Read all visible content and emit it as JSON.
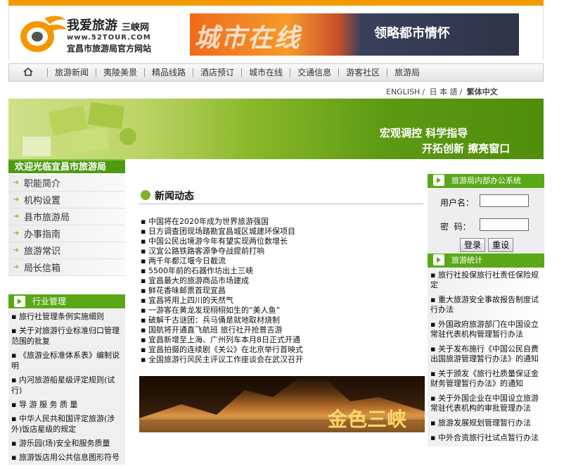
{
  "header": {
    "logo_name": "我爱旅游",
    "logo_site": "三峡网",
    "logo_url": "www.52TOUR.COM",
    "logo_sub": "宜昌市旅游局官方网站",
    "banner_text": "城市在线",
    "banner_sub": "领略都市情怀"
  },
  "nav": {
    "items": [
      "旅游新闻",
      "夷陵美景",
      "精品线路",
      "酒店预订",
      "城市在线",
      "交通信息",
      "游客社区",
      "旅游局"
    ]
  },
  "lang": {
    "english": "ENGLISH",
    "japanese": "日 本 語",
    "traditional": "繁体中文"
  },
  "hero": {
    "line1": "宏观调控 科学指导",
    "line2": "开拓创新 擦亮窗口"
  },
  "left": {
    "welcome": "欢迎光临宜昌市旅游局",
    "menu": [
      "职能简介",
      "机构设置",
      "县市旅游局",
      "办事指南",
      "旅游常识",
      "局长信箱"
    ],
    "industry_title": "行业管理",
    "industry": [
      "▪ 旅行社管理条例实施细则",
      "▪ 关于对旅游行业标准归口管理范围的批复",
      "▪ 《旅游业标准体系表》编制说明",
      "▪ 内河旅游船星级评定规则(试行)",
      "▪ 导 游 服 务 质 量",
      "▪ 中华人民共和国评定旅游(涉外)饭店星级的规定",
      "▪ 游乐园(场)安全和服务质量",
      "▪ 旅游饭店用公共信息图形符号"
    ]
  },
  "news": {
    "title": "新闻动态",
    "items": [
      "中国将在2020年成为世界旅游强国",
      "日方调查团现场踏勘宜昌城区城建环保项目",
      "中国公民出境游今年有望实现两位数增长",
      "汉宜公路铁路客源争夺战提前打响",
      "两千年都江堰今日截流",
      "5500年前的石器作坊出土三峡",
      "宜昌最大的旅游商品市场建成",
      "鲜花香味邮票首现宜昌",
      "宜昌将用上四川的天然气",
      "一游客在黄龙发现栩栩如生的“美人鱼”",
      "破解千古谜团：兵马俑是就地取材烧制",
      "国航将开通直飞航班 旅行社开抢普吉游",
      "宜昌新增至上海、广州列车本月8日正式开通",
      "宜昌拍摄的连续剧《关公》在北京举行首映式",
      "全国旅游行风民主评议工作座谈会在武汉召开"
    ],
    "photo_caption": "金色三峡"
  },
  "right": {
    "office_title": "旅游局内部办公系统",
    "username_label": "用户名：",
    "password_label": "密  码：",
    "username_value": "",
    "password_value": "",
    "login_btn": "登录",
    "reset_btn": "重设",
    "stats_title": "旅游统计",
    "stats": [
      "▪ 旅行社投保旅行社责任保险规定",
      "▪ 重大旅游安全事故报告制度试行办法",
      "▪ 外国政府旅游部门在中国设立常驻代表机构管理暂行办法",
      "▪ 关于发布施行《中国公民自费出国旅游管理暂行办法》的通知",
      "▪ 关于颁发《旅行社质量保证金财务管理暂行办法》的通知",
      "▪ 关于外国企业在中国设立旅游常驻代表机构的审批管理办法",
      "▪ 旅游发展规划管理暂行办法",
      "▪ 中外合资旅行社试点暂行办法"
    ]
  },
  "colors": {
    "orange": "#f39800",
    "green": "#5aa818"
  }
}
